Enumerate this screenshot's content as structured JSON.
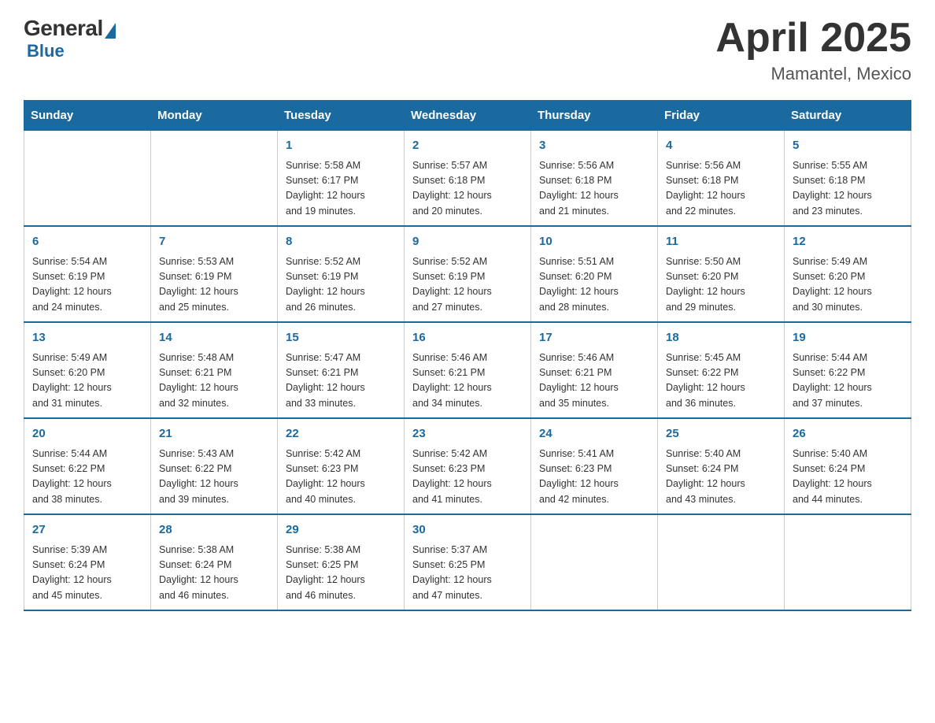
{
  "logo": {
    "general_text": "General",
    "blue_text": "Blue"
  },
  "title": {
    "main": "April 2025",
    "sub": "Mamantel, Mexico"
  },
  "weekdays": [
    "Sunday",
    "Monday",
    "Tuesday",
    "Wednesday",
    "Thursday",
    "Friday",
    "Saturday"
  ],
  "weeks": [
    [
      {
        "day": "",
        "info": ""
      },
      {
        "day": "",
        "info": ""
      },
      {
        "day": "1",
        "info": "Sunrise: 5:58 AM\nSunset: 6:17 PM\nDaylight: 12 hours\nand 19 minutes."
      },
      {
        "day": "2",
        "info": "Sunrise: 5:57 AM\nSunset: 6:18 PM\nDaylight: 12 hours\nand 20 minutes."
      },
      {
        "day": "3",
        "info": "Sunrise: 5:56 AM\nSunset: 6:18 PM\nDaylight: 12 hours\nand 21 minutes."
      },
      {
        "day": "4",
        "info": "Sunrise: 5:56 AM\nSunset: 6:18 PM\nDaylight: 12 hours\nand 22 minutes."
      },
      {
        "day": "5",
        "info": "Sunrise: 5:55 AM\nSunset: 6:18 PM\nDaylight: 12 hours\nand 23 minutes."
      }
    ],
    [
      {
        "day": "6",
        "info": "Sunrise: 5:54 AM\nSunset: 6:19 PM\nDaylight: 12 hours\nand 24 minutes."
      },
      {
        "day": "7",
        "info": "Sunrise: 5:53 AM\nSunset: 6:19 PM\nDaylight: 12 hours\nand 25 minutes."
      },
      {
        "day": "8",
        "info": "Sunrise: 5:52 AM\nSunset: 6:19 PM\nDaylight: 12 hours\nand 26 minutes."
      },
      {
        "day": "9",
        "info": "Sunrise: 5:52 AM\nSunset: 6:19 PM\nDaylight: 12 hours\nand 27 minutes."
      },
      {
        "day": "10",
        "info": "Sunrise: 5:51 AM\nSunset: 6:20 PM\nDaylight: 12 hours\nand 28 minutes."
      },
      {
        "day": "11",
        "info": "Sunrise: 5:50 AM\nSunset: 6:20 PM\nDaylight: 12 hours\nand 29 minutes."
      },
      {
        "day": "12",
        "info": "Sunrise: 5:49 AM\nSunset: 6:20 PM\nDaylight: 12 hours\nand 30 minutes."
      }
    ],
    [
      {
        "day": "13",
        "info": "Sunrise: 5:49 AM\nSunset: 6:20 PM\nDaylight: 12 hours\nand 31 minutes."
      },
      {
        "day": "14",
        "info": "Sunrise: 5:48 AM\nSunset: 6:21 PM\nDaylight: 12 hours\nand 32 minutes."
      },
      {
        "day": "15",
        "info": "Sunrise: 5:47 AM\nSunset: 6:21 PM\nDaylight: 12 hours\nand 33 minutes."
      },
      {
        "day": "16",
        "info": "Sunrise: 5:46 AM\nSunset: 6:21 PM\nDaylight: 12 hours\nand 34 minutes."
      },
      {
        "day": "17",
        "info": "Sunrise: 5:46 AM\nSunset: 6:21 PM\nDaylight: 12 hours\nand 35 minutes."
      },
      {
        "day": "18",
        "info": "Sunrise: 5:45 AM\nSunset: 6:22 PM\nDaylight: 12 hours\nand 36 minutes."
      },
      {
        "day": "19",
        "info": "Sunrise: 5:44 AM\nSunset: 6:22 PM\nDaylight: 12 hours\nand 37 minutes."
      }
    ],
    [
      {
        "day": "20",
        "info": "Sunrise: 5:44 AM\nSunset: 6:22 PM\nDaylight: 12 hours\nand 38 minutes."
      },
      {
        "day": "21",
        "info": "Sunrise: 5:43 AM\nSunset: 6:22 PM\nDaylight: 12 hours\nand 39 minutes."
      },
      {
        "day": "22",
        "info": "Sunrise: 5:42 AM\nSunset: 6:23 PM\nDaylight: 12 hours\nand 40 minutes."
      },
      {
        "day": "23",
        "info": "Sunrise: 5:42 AM\nSunset: 6:23 PM\nDaylight: 12 hours\nand 41 minutes."
      },
      {
        "day": "24",
        "info": "Sunrise: 5:41 AM\nSunset: 6:23 PM\nDaylight: 12 hours\nand 42 minutes."
      },
      {
        "day": "25",
        "info": "Sunrise: 5:40 AM\nSunset: 6:24 PM\nDaylight: 12 hours\nand 43 minutes."
      },
      {
        "day": "26",
        "info": "Sunrise: 5:40 AM\nSunset: 6:24 PM\nDaylight: 12 hours\nand 44 minutes."
      }
    ],
    [
      {
        "day": "27",
        "info": "Sunrise: 5:39 AM\nSunset: 6:24 PM\nDaylight: 12 hours\nand 45 minutes."
      },
      {
        "day": "28",
        "info": "Sunrise: 5:38 AM\nSunset: 6:24 PM\nDaylight: 12 hours\nand 46 minutes."
      },
      {
        "day": "29",
        "info": "Sunrise: 5:38 AM\nSunset: 6:25 PM\nDaylight: 12 hours\nand 46 minutes."
      },
      {
        "day": "30",
        "info": "Sunrise: 5:37 AM\nSunset: 6:25 PM\nDaylight: 12 hours\nand 47 minutes."
      },
      {
        "day": "",
        "info": ""
      },
      {
        "day": "",
        "info": ""
      },
      {
        "day": "",
        "info": ""
      }
    ]
  ]
}
